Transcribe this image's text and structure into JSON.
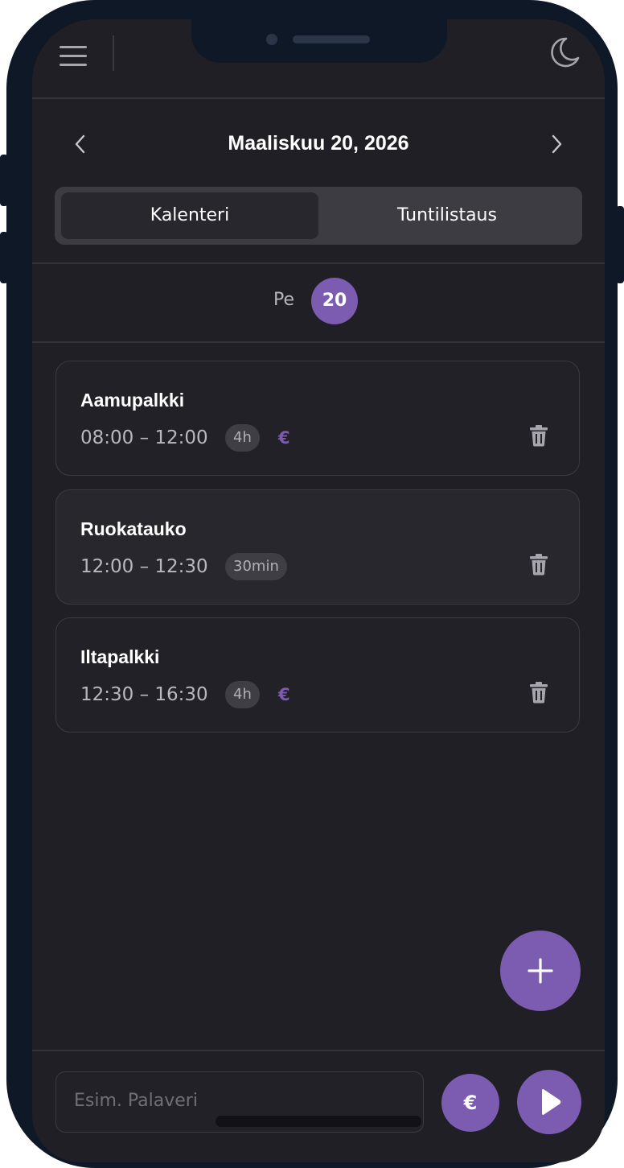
{
  "colors": {
    "accent": "#7b5cb0",
    "background": "#201f25",
    "device_frame": "#0f1826",
    "card_border": "#3c3b42",
    "muted_text": "#b9b8bf"
  },
  "header": {
    "menu_icon": "hamburger-menu-icon",
    "theme_icon": "moon-icon"
  },
  "date_nav": {
    "title": "Maaliskuu 20, 2026",
    "prev_icon": "chevron-left-icon",
    "next_icon": "chevron-right-icon"
  },
  "tabs": [
    {
      "label": "Kalenteri",
      "active": true
    },
    {
      "label": "Tuntilistaus",
      "active": false
    }
  ],
  "day": {
    "weekday": "Pe",
    "number": "20"
  },
  "entries": [
    {
      "title": "Aamupalkki",
      "time": "08:00 – 12:00",
      "duration": "4h",
      "billable_symbol": "€"
    },
    {
      "title": "Ruokatauko",
      "time": "12:00 – 12:30",
      "duration": "30min",
      "billable_symbol": ""
    },
    {
      "title": "Iltapalkki",
      "time": "12:30 – 16:30",
      "duration": "4h",
      "billable_symbol": "€"
    }
  ],
  "fab": {
    "icon": "plus-icon"
  },
  "bottom_bar": {
    "input_placeholder": "Esim. Palaveri",
    "euro_label": "€",
    "play_icon": "play-icon"
  }
}
